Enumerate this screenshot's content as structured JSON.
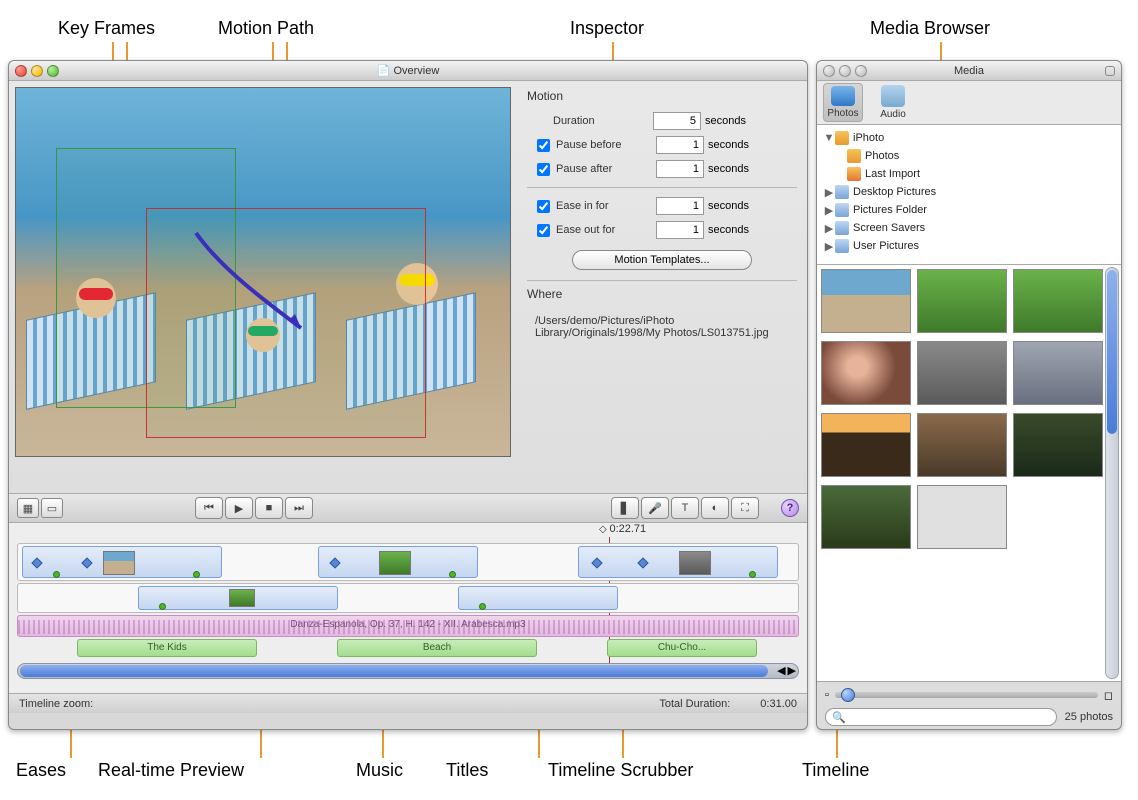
{
  "annotations": {
    "top": {
      "keyframes": "Key Frames",
      "motion_path": "Motion Path",
      "inspector": "Inspector",
      "media_browser": "Media Browser"
    },
    "bottom": {
      "eases": "Eases",
      "preview": "Real-time Preview",
      "music": "Music",
      "titles": "Titles",
      "scrubber": "Timeline Scrubber",
      "timeline": "Timeline"
    }
  },
  "main_window": {
    "title": "Overview",
    "inspector": {
      "motion_header": "Motion",
      "duration_label": "Duration",
      "duration_value": "5",
      "seconds": "seconds",
      "pause_before_label": "Pause before",
      "pause_before_value": "1",
      "pause_after_label": "Pause after",
      "pause_after_value": "1",
      "ease_in_label": "Ease in for",
      "ease_in_value": "1",
      "ease_out_label": "Ease out for",
      "ease_out_value": "1",
      "templates_button": "Motion Templates...",
      "where_header": "Where",
      "where_path": "/Users/demo/Pictures/iPhoto Library/Originals/1998/My Photos/LS013751.jpg"
    },
    "timeline": {
      "scrubber_time": "0:22.71",
      "music_label": "Danza-Espanola, Op. 37, H. 142 - XII. Arabesca.mp3",
      "titles": [
        "The Kids",
        "Beach",
        "Chu-Cho..."
      ],
      "zoom_label": "Timeline zoom:",
      "total_label": "Total Duration:",
      "total_value": "0:31.00"
    }
  },
  "media_window": {
    "title": "Media",
    "tabs": {
      "photos": "Photos",
      "audio": "Audio"
    },
    "tree": {
      "iphoto": "iPhoto",
      "photos": "Photos",
      "last_import": "Last Import",
      "desktop_pictures": "Desktop Pictures",
      "pictures_folder": "Pictures Folder",
      "screen_savers": "Screen Savers",
      "user_pictures": "User Pictures"
    },
    "footer": {
      "search_placeholder": "",
      "count": "25 photos"
    }
  }
}
